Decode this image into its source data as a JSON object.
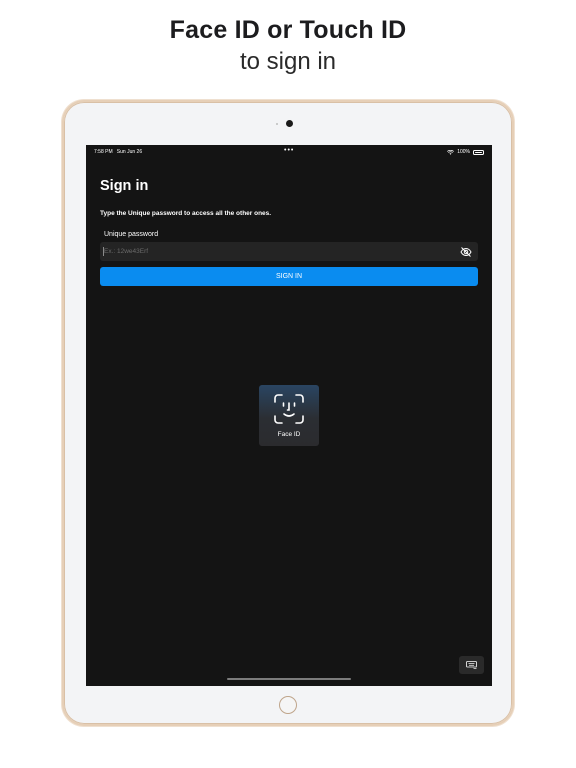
{
  "promo": {
    "headline": "Face ID or Touch ID",
    "subheadline": "to sign in"
  },
  "status_bar": {
    "time": "7:58 PM",
    "date": "Sun Jun 26",
    "center_dots": "•••",
    "battery": "100%",
    "icons": [
      "wifi-icon",
      "battery-icon"
    ]
  },
  "signin": {
    "title": "Sign in",
    "instruction": "Type the Unique password to access all the other ones.",
    "field_label": "Unique password",
    "field_value": "",
    "field_placeholder": "Ex.: 12we43Erf",
    "button_label": "SIGN IN"
  },
  "face_id": {
    "label": "Face ID",
    "icon": "face-id-icon"
  },
  "colors": {
    "accent": "#0a8cf0",
    "screen_background": "#141414",
    "field_background": "#242424",
    "device_frame": "#e6cfb7"
  }
}
